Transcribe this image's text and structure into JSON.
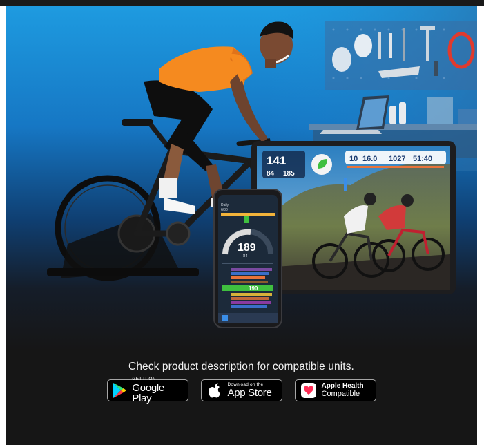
{
  "caption": "Check product description for compatible units.",
  "badges": {
    "google_play": {
      "top": "GET IT ON",
      "main": "Google Play",
      "icon": "google-play-icon"
    },
    "app_store": {
      "top": "Download on the",
      "main": "App Store",
      "icon": "apple-icon"
    },
    "apple_health": {
      "top": "Apple Health",
      "main": "Compatible",
      "icon": "apple-health-icon"
    }
  },
  "tablet_hud": {
    "power": "141",
    "hr": "84",
    "cadence": "185",
    "distance": "10",
    "speed": "16.0",
    "elevation": "1027",
    "time": "51:40"
  },
  "phone_app": {
    "header_left": "Daily",
    "header_value": "6/30",
    "gauge_value": "189",
    "gauge_sub": "84",
    "row_value": "190"
  },
  "colors": {
    "background": "#161616",
    "jersey": "#f58a1f",
    "accent_green": "#3fbf3f",
    "sky": "#1f8fd6"
  }
}
